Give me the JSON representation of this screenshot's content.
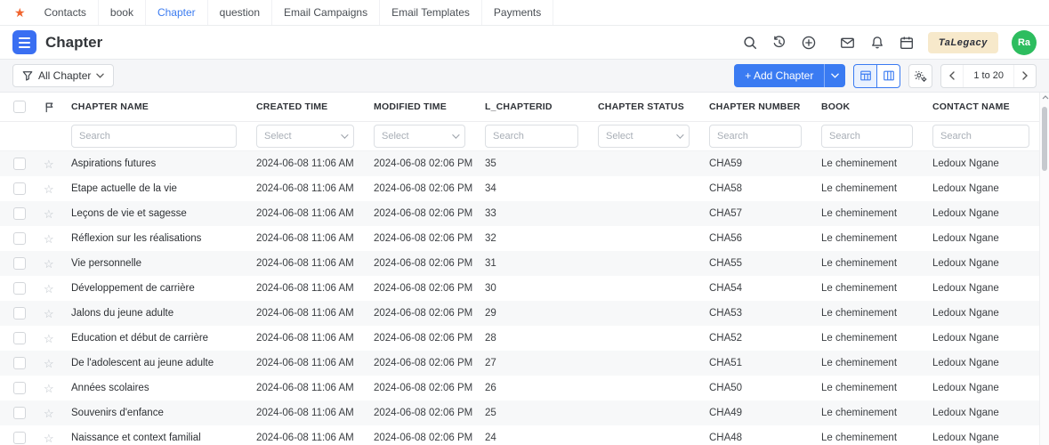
{
  "topnav": {
    "items": [
      {
        "label": "Contacts",
        "active": false
      },
      {
        "label": "book",
        "active": false
      },
      {
        "label": "Chapter",
        "active": true
      },
      {
        "label": "question",
        "active": false
      },
      {
        "label": "Email Campaigns",
        "active": false
      },
      {
        "label": "Email Templates",
        "active": false
      },
      {
        "label": "Payments",
        "active": false
      }
    ]
  },
  "appbar": {
    "title": "Chapter",
    "logo_text": "TaLegacy",
    "avatar_initials": "Ra",
    "icon_names": [
      "search-icon",
      "history-icon",
      "add-circle-icon",
      "mail-icon",
      "bell-icon",
      "calendar-icon"
    ]
  },
  "toolbar": {
    "filter_button": "All Chapter",
    "add_button": "+ Add Chapter",
    "pagination_range": "1 to 20",
    "icon_names": [
      "funnel-icon",
      "chevron-down-icon",
      "table-view-icon",
      "kanban-view-icon",
      "gear-icon",
      "chevron-left-icon",
      "chevron-right-icon"
    ]
  },
  "table": {
    "columns": [
      "CHAPTER NAME",
      "CREATED TIME",
      "MODIFIED TIME",
      "L_CHAPTERID",
      "CHAPTER STATUS",
      "CHAPTER NUMBER",
      "BOOK",
      "CONTACT NAME"
    ],
    "filters": {
      "chapter_name": {
        "type": "search",
        "placeholder": "Search"
      },
      "created_time": {
        "type": "select",
        "placeholder": "Select"
      },
      "modified_time": {
        "type": "select",
        "placeholder": "Select"
      },
      "l_chapterid": {
        "type": "search",
        "placeholder": "Search"
      },
      "chapter_status": {
        "type": "select",
        "placeholder": "Select"
      },
      "chapter_number": {
        "type": "search",
        "placeholder": "Search"
      },
      "book": {
        "type": "search",
        "placeholder": "Search"
      },
      "contact_name": {
        "type": "search",
        "placeholder": "Search"
      }
    },
    "rows": [
      {
        "name": "Aspirations futures",
        "created": "2024-06-08 11:06 AM",
        "modified": "2024-06-08 02:06 PM",
        "chapter_id": "35",
        "status": "",
        "number": "CHA59",
        "book": "Le cheminement",
        "contact": "Ledoux Ngane"
      },
      {
        "name": "Étape actuelle de la vie",
        "created": "2024-06-08 11:06 AM",
        "modified": "2024-06-08 02:06 PM",
        "chapter_id": "34",
        "status": "",
        "number": "CHA58",
        "book": "Le cheminement",
        "contact": "Ledoux Ngane"
      },
      {
        "name": "Leçons de vie et sagesse",
        "created": "2024-06-08 11:06 AM",
        "modified": "2024-06-08 02:06 PM",
        "chapter_id": "33",
        "status": "",
        "number": "CHA57",
        "book": "Le cheminement",
        "contact": "Ledoux Ngane"
      },
      {
        "name": "Réflexion sur les réalisations",
        "created": "2024-06-08 11:06 AM",
        "modified": "2024-06-08 02:06 PM",
        "chapter_id": "32",
        "status": "",
        "number": "CHA56",
        "book": "Le cheminement",
        "contact": "Ledoux Ngane"
      },
      {
        "name": "Vie personnelle",
        "created": "2024-06-08 11:06 AM",
        "modified": "2024-06-08 02:06 PM",
        "chapter_id": "31",
        "status": "",
        "number": "CHA55",
        "book": "Le cheminement",
        "contact": "Ledoux Ngane"
      },
      {
        "name": "Développement de carrière",
        "created": "2024-06-08 11:06 AM",
        "modified": "2024-06-08 02:06 PM",
        "chapter_id": "30",
        "status": "",
        "number": "CHA54",
        "book": "Le cheminement",
        "contact": "Ledoux Ngane"
      },
      {
        "name": "Jalons du jeune adulte",
        "created": "2024-06-08 11:06 AM",
        "modified": "2024-06-08 02:06 PM",
        "chapter_id": "29",
        "status": "",
        "number": "CHA53",
        "book": "Le cheminement",
        "contact": "Ledoux Ngane"
      },
      {
        "name": "Éducation et début de carrière",
        "created": "2024-06-08 11:06 AM",
        "modified": "2024-06-08 02:06 PM",
        "chapter_id": "28",
        "status": "",
        "number": "CHA52",
        "book": "Le cheminement",
        "contact": "Ledoux Ngane"
      },
      {
        "name": "De l'adolescent au jeune adulte",
        "created": "2024-06-08 11:06 AM",
        "modified": "2024-06-08 02:06 PM",
        "chapter_id": "27",
        "status": "",
        "number": "CHA51",
        "book": "Le cheminement",
        "contact": "Ledoux Ngane"
      },
      {
        "name": "Années scolaires",
        "created": "2024-06-08 11:06 AM",
        "modified": "2024-06-08 02:06 PM",
        "chapter_id": "26",
        "status": "",
        "number": "CHA50",
        "book": "Le cheminement",
        "contact": "Ledoux Ngane"
      },
      {
        "name": "Souvenirs d'enfance",
        "created": "2024-06-08 11:06 AM",
        "modified": "2024-06-08 02:06 PM",
        "chapter_id": "25",
        "status": "",
        "number": "CHA49",
        "book": "Le cheminement",
        "contact": "Ledoux Ngane"
      },
      {
        "name": "Naissance et context familial",
        "created": "2024-06-08 11:06 AM",
        "modified": "2024-06-08 02:06 PM",
        "chapter_id": "24",
        "status": "",
        "number": "CHA48",
        "book": "Le cheminement",
        "contact": "Ledoux Ngane"
      }
    ]
  },
  "colors": {
    "accent_blue": "#3a7bf2",
    "nav_active_blue": "#3c7cf0",
    "avatar_green": "#2dbd5f",
    "logo_chip_bg": "#f7e9cb",
    "star_orange": "#f0642e",
    "toolbar_bg": "#f5f6f8",
    "row_alt_bg": "#f7f8f9"
  }
}
